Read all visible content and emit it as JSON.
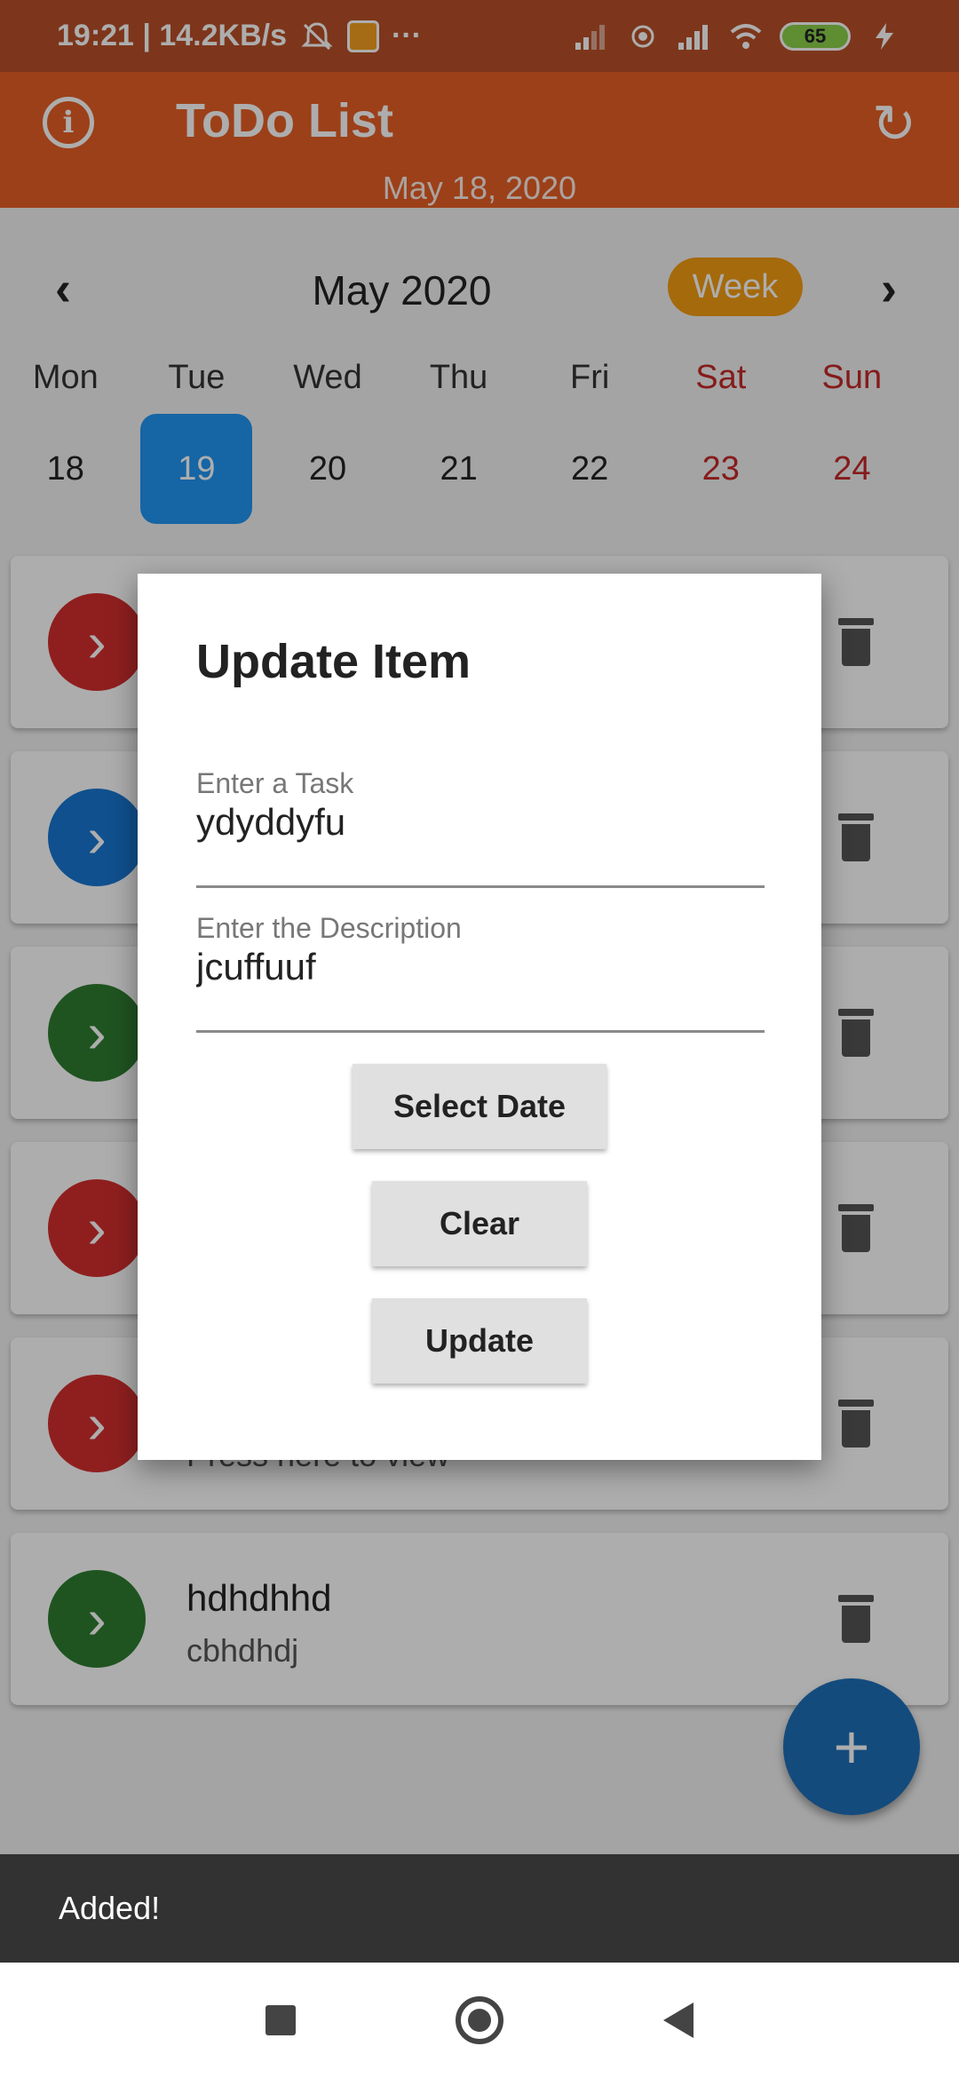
{
  "status_bar": {
    "time_speed": "19:21 | 14.2KB/s",
    "more": "···",
    "battery": "65"
  },
  "app_bar": {
    "title": "ToDo List",
    "date": "May 18, 2020",
    "info_icon": "info-icon",
    "refresh_icon": "refresh-icon"
  },
  "calendar": {
    "month": "May 2020",
    "prev": "‹",
    "next": "›",
    "view_toggle": "Week",
    "days": [
      "Mon",
      "Tue",
      "Wed",
      "Thu",
      "Fri",
      "Sat",
      "Sun"
    ],
    "dates": [
      "18",
      "19",
      "20",
      "21",
      "22",
      "23",
      "24"
    ],
    "selected_index": 1,
    "selected_color": "#2196f3",
    "weekend_color": "#c62828"
  },
  "list": {
    "items": [
      {
        "color": "#d32f2f",
        "title": "",
        "description": ""
      },
      {
        "color": "#1976d2",
        "title": "",
        "description": ""
      },
      {
        "color": "#2e7d32",
        "title": "",
        "description": ""
      },
      {
        "color": "#d32f2f",
        "title": "",
        "description": ""
      },
      {
        "color": "#d32f2f",
        "title": "",
        "description": "Press here to view"
      },
      {
        "color": "#2e7d32",
        "title": "hdhdhhd",
        "description": "cbhdhdj"
      }
    ]
  },
  "dialog": {
    "title": "Update Item",
    "task_label": "Enter a Task",
    "task_value": "ydyddyfu",
    "description_label": "Enter the Description",
    "description_value": "jcuffuuf",
    "select_date": "Select Date",
    "clear": "Clear",
    "update": "Update"
  },
  "fab": {
    "label": "+"
  },
  "snackbar": {
    "message": "Added!"
  }
}
